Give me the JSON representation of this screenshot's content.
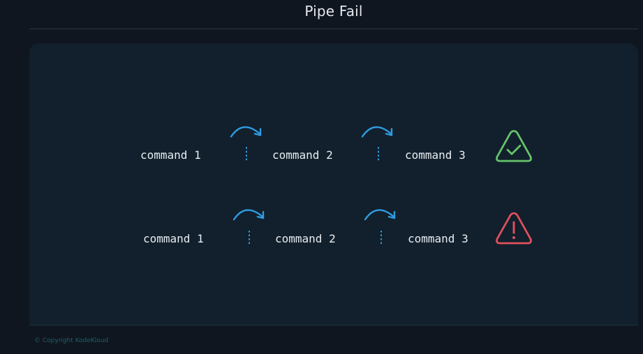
{
  "header": {
    "title": "Pipe Fail"
  },
  "rows": [
    {
      "commands": [
        "command 1",
        "command 2",
        "command 3"
      ],
      "status_icon": "check-triangle-icon",
      "status_color": "#66c46a"
    },
    {
      "commands": [
        "command 1",
        "command 2",
        "command 3"
      ],
      "status_icon": "warning-triangle-icon",
      "status_color": "#e0505d"
    }
  ],
  "colors": {
    "accent_blue": "#2f9be0",
    "background": "#0f1620",
    "panel": "#11202c"
  },
  "footer": {
    "copyright": "© Copyright KodeKloud"
  }
}
